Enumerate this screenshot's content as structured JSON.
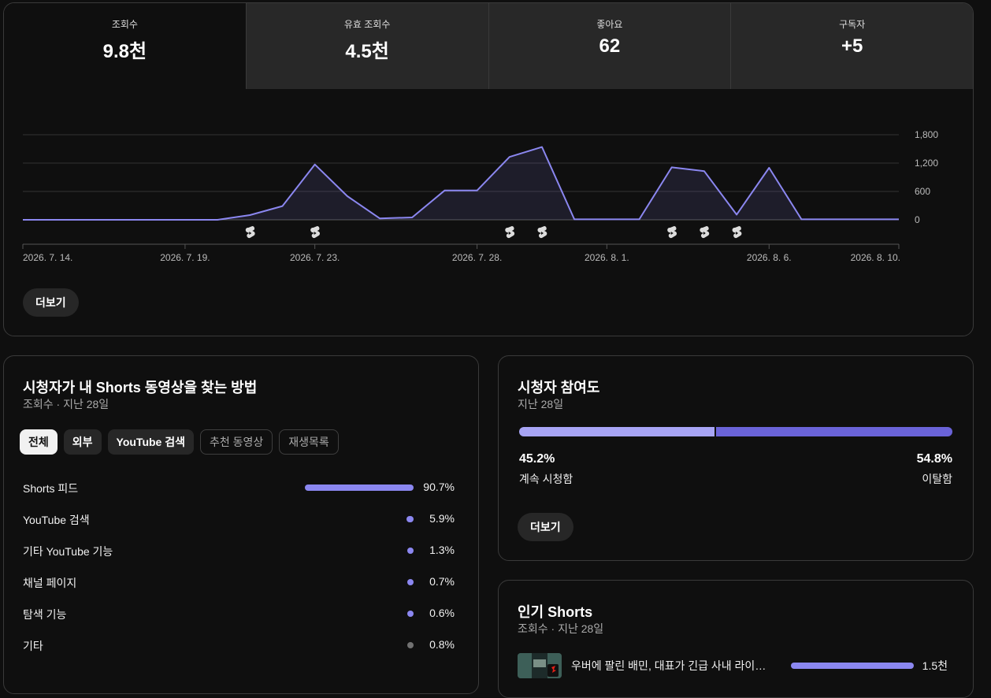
{
  "stats": [
    {
      "label": "조회수",
      "value": "9.8천"
    },
    {
      "label": "유효 조회수",
      "value": "4.5천"
    },
    {
      "label": "좋아요",
      "value": "62"
    },
    {
      "label": "구독자",
      "value": "+5"
    }
  ],
  "overview": {
    "more_label": "더보기"
  },
  "chart_data": {
    "type": "area",
    "x": [
      "2026. 7. 14.",
      "2026. 7. 15.",
      "2026. 7. 16.",
      "2026. 7. 17.",
      "2026. 7. 18.",
      "2026. 7. 19.",
      "2026. 7. 20.",
      "2026. 7. 21.",
      "2026. 7. 22.",
      "2026. 7. 23.",
      "2026. 7. 24.",
      "2026. 7. 25.",
      "2026. 7. 26.",
      "2026. 7. 27.",
      "2026. 7. 28.",
      "2026. 7. 29.",
      "2026. 7. 30.",
      "2026. 7. 31.",
      "2026. 8. 1.",
      "2026. 8. 2.",
      "2026. 8. 3.",
      "2026. 8. 4.",
      "2026. 8. 5.",
      "2026. 8. 6.",
      "2026. 8. 7.",
      "2026. 8. 8.",
      "2026. 8. 9.",
      "2026. 8. 10."
    ],
    "series": [
      {
        "values": [
          0,
          0,
          0,
          0,
          0,
          0,
          0,
          100,
          290,
          1170,
          500,
          30,
          50,
          620,
          620,
          1330,
          1540,
          10,
          10,
          10,
          1110,
          1030,
          110,
          1100,
          10,
          10,
          10,
          10
        ]
      }
    ],
    "ylim": [
      0,
      1800
    ],
    "yticks": [
      "1,800",
      "1,200",
      "600",
      "0"
    ],
    "ytick_values": [
      1800,
      1200,
      600,
      0
    ],
    "xtick_labels": [
      "2026. 7. 14.",
      "2026. 7. 19.",
      "2026. 7. 23.",
      "2026. 7. 28.",
      "2026. 8. 1.",
      "2026. 8. 6.",
      "2026. 8. 10."
    ],
    "xtick_dates": [
      "2026. 7. 14.",
      "2026. 7. 19.",
      "2026. 7. 23.",
      "2026. 7. 28.",
      "2026. 8. 1.",
      "2026. 8. 6.",
      "2026. 8. 10."
    ],
    "marker_dates": [
      "2026. 7. 21.",
      "2026. 7. 23.",
      "2026. 7. 29.",
      "2026. 7. 30.",
      "2026. 8. 3.",
      "2026. 8. 4.",
      "2026. 8. 5."
    ],
    "marker_icon": "shorts-icon",
    "grid": true,
    "line_color": "#8b87f0"
  },
  "traffic": {
    "title": "시청자가 내 Shorts 동영상을 찾는 방법",
    "subtitle": "조회수 · 지난 28일",
    "chips": [
      {
        "label": "전체",
        "state": "selected"
      },
      {
        "label": "외부",
        "state": "normal"
      },
      {
        "label": "YouTube 검색",
        "state": "normal"
      },
      {
        "label": "추천 동영상",
        "state": "outline"
      },
      {
        "label": "재생목록",
        "state": "outline"
      }
    ],
    "rows": [
      {
        "label": "Shorts 피드",
        "pct": "90.7%",
        "value": 90.7,
        "color": "#8b87f0"
      },
      {
        "label": "YouTube 검색",
        "pct": "5.9%",
        "value": 5.9,
        "color": "#8b87f0"
      },
      {
        "label": "기타 YouTube 기능",
        "pct": "1.3%",
        "value": 1.3,
        "color": "#8b87f0"
      },
      {
        "label": "채널 페이지",
        "pct": "0.7%",
        "value": 0.7,
        "color": "#8b87f0"
      },
      {
        "label": "탐색 기능",
        "pct": "0.6%",
        "value": 0.6,
        "color": "#8b87f0"
      },
      {
        "label": "기타",
        "pct": "0.8%",
        "value": 0.8,
        "color": "#717171"
      }
    ]
  },
  "engagement": {
    "title": "시청자 참여도",
    "subtitle": "지난 28일",
    "stayed_pct": "45.2%",
    "stayed_value": 45.2,
    "stayed_label": "계속 시청함",
    "swiped_pct": "54.8%",
    "swiped_value": 54.8,
    "swiped_label": "이탈함",
    "stayed_color": "#a7a4f4",
    "swiped_color": "#6a63d8",
    "more_label": "더보기"
  },
  "top_shorts": {
    "title": "인기 Shorts",
    "subtitle": "조회수 · 지난 28일",
    "items": [
      {
        "title": "우버에 팔린 배민, 대표가 긴급 사내 라이브 방송 켠 이유",
        "views": "1.5천",
        "share": 1.0
      }
    ]
  }
}
